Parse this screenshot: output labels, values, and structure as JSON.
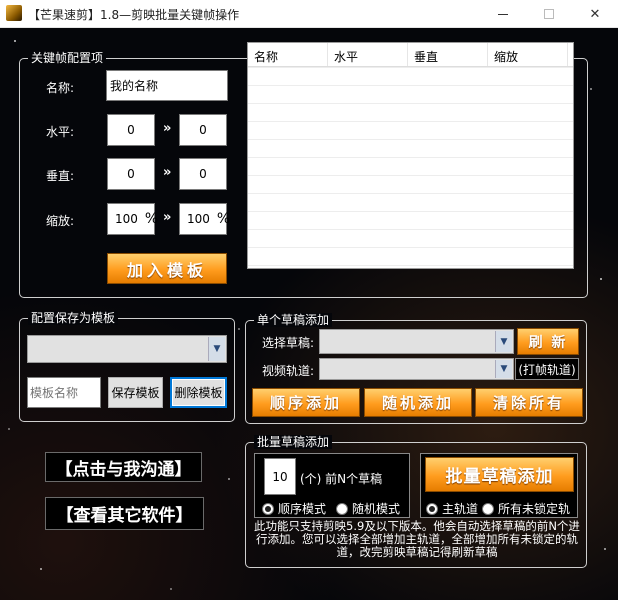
{
  "window": {
    "title": "【芒果速剪】1.8—剪映批量关键帧操作",
    "min_glyph": "—",
    "max_glyph": "☐",
    "close_glyph": "✕"
  },
  "keyframe": {
    "group_label": "关键帧配置项",
    "name_label": "名称:",
    "name_value": "我的名称",
    "horizontal_label": "水平:",
    "horizontal_from": "0",
    "horizontal_to": "0",
    "vertical_label": "垂直:",
    "vertical_from": "0",
    "vertical_to": "0",
    "scale_label": "缩放:",
    "scale_from": "100",
    "scale_to": "100",
    "percent": "%",
    "arrow": "»",
    "add_button": "加入模板"
  },
  "table": {
    "columns": [
      "名称",
      "水平",
      "垂直",
      "缩放"
    ],
    "rows": []
  },
  "template": {
    "group_label": "配置保存为模板",
    "selected": "",
    "name_placeholder": "模板名称",
    "save_button": "保存模板",
    "delete_button": "删除模板"
  },
  "single": {
    "group_label": "单个草稿添加",
    "draft_label": "选择草稿:",
    "draft_value": "",
    "refresh_button": "刷 新",
    "track_label": "视频轨道:",
    "track_value": "",
    "track_hint": "(打帧轨道)",
    "seq_button": "顺序添加",
    "random_button": "随机添加",
    "clear_button": "清除所有"
  },
  "batch": {
    "group_label": "批量草稿添加",
    "count_value": "10",
    "count_suffix": "(个) 前N个草稿",
    "mode_seq": "顺序模式",
    "mode_random": "随机模式",
    "batch_button": "批量草稿添加",
    "track_main": "主轨道",
    "track_all": "所有未锁定轨",
    "note": "此功能只支持剪映5.9及以下版本。他会自动选择草稿的前N个进行添加。您可以选择全部增加主轨道，全部增加所有未锁定的轨道，改完剪映草稿记得刷新草稿"
  },
  "links": {
    "contact": "【点击与我沟通】",
    "other_software": "【查看其它软件】"
  },
  "colors": {
    "accent_orange": "#ff9c1e",
    "background": "#05060a",
    "focus_blue": "#0078d7"
  },
  "icons": {
    "app": "mango-app-icon",
    "dropdown": "chevron-down-icon"
  }
}
